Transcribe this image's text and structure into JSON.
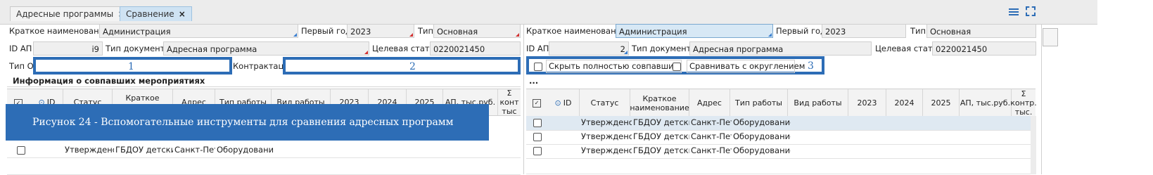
{
  "tabs": [
    {
      "label": "Адресные программы",
      "close": "×"
    },
    {
      "label": "Сравнение",
      "close": "×"
    }
  ],
  "left": {
    "short_name_label": "Краткое наименование",
    "short_name_value": "Администрация",
    "first_year_label": "Первый год",
    "first_year_value": "2023",
    "type_label": "Тип",
    "type_value": "Основная",
    "id_label": "ID АП",
    "id_value": "i9",
    "doc_type_label": "Тип документа",
    "doc_type_value": "Адресная программа",
    "target_label": "Целевая статья",
    "target_value": "0220021450",
    "oy_type_label": "Тип ОУ",
    "contracting_label": "Контрактация",
    "section_title": "Информация о совпавших мероприятиях",
    "callout1": "1",
    "callout2": "2"
  },
  "right": {
    "short_name_label": "Краткое наименование",
    "short_name_value": "Администрация",
    "first_year_label": "Первый год",
    "first_year_value": "2023",
    "type_label": "Тип",
    "type_value": "Основная",
    "id_label": "ID АП",
    "id_value": "2",
    "doc_type_label": "Тип документа",
    "doc_type_value": "Адресная программа",
    "target_label": "Целевая статья",
    "target_value": "0220021450",
    "hide_match_label": "Скрыть полностью совпавшие",
    "round_label": "Сравнивать с округлением",
    "callout3": "3",
    "dots": "..."
  },
  "table_headers": {
    "id": "ID",
    "status": "Статус",
    "short_name": "Краткое наименование",
    "address": "Адрес",
    "work_type": "Тип работы",
    "work_kind": "Вид работы",
    "y2023": "2023",
    "y2024": "2024",
    "y2025": "2025",
    "ap": "АП, тыс.руб.",
    "sum": "Σ контр. тыс."
  },
  "left_headers": {
    "status": "Статус",
    "short_name": "Краткое наименов",
    "address": "Адрес",
    "work_type": "Тип работы",
    "work_kind": "Вид работы",
    "ap": "АП, тыс.руб.",
    "sum": "Σ конт тыс"
  },
  "row_values": {
    "status": "Утверждено",
    "short_name": "ГБДОУ детский",
    "address": "Санкт-Петер",
    "work_type": "Оборудование"
  },
  "caption": "Рисунок 24 - Вспомогательные инструменты для сравнения адресных программ"
}
